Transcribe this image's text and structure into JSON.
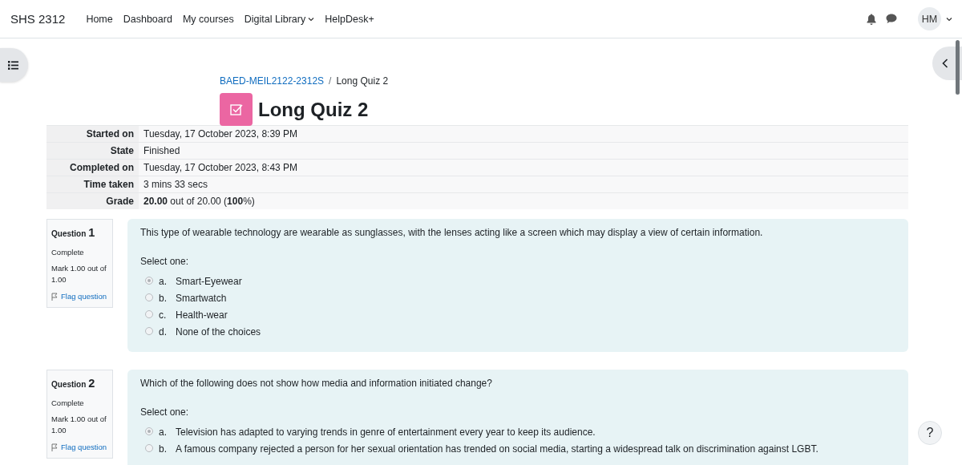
{
  "header": {
    "site_name": "SHS 2312",
    "nav": [
      {
        "label": "Home",
        "dropdown": false
      },
      {
        "label": "Dashboard",
        "dropdown": false
      },
      {
        "label": "My courses",
        "dropdown": false
      },
      {
        "label": "Digital Library",
        "dropdown": true
      },
      {
        "label": "HelpDesk+",
        "dropdown": false
      }
    ],
    "user_initials": "HM"
  },
  "breadcrumb_separator": "/",
  "breadcrumb": [
    {
      "label": "BAED-MEIL2122-2312S",
      "link": true
    },
    {
      "label": "Long Quiz 2",
      "link": false
    }
  ],
  "page_title": "Long Quiz 2",
  "summary": [
    {
      "label": "Started on",
      "value": "Tuesday, 17 October 2023, 8:39 PM"
    },
    {
      "label": "State",
      "value": "Finished"
    },
    {
      "label": "Completed on",
      "value": "Tuesday, 17 October 2023, 8:43 PM"
    },
    {
      "label": "Time taken",
      "value": "3 mins 33 secs"
    },
    {
      "label": "Grade",
      "value": "**20.00** out of 20.00 (**100**%)"
    }
  ],
  "questions": [
    {
      "number_label": "Question",
      "number": "1",
      "status": "Complete",
      "mark": "Mark 1.00 out of 1.00",
      "flag_label": "Flag question",
      "text": "This type of wearable technology are wearable as sunglasses, with the lenses acting like a screen which may display a view of certain information.",
      "prompt": "Select one:",
      "options": [
        {
          "letter": "a.",
          "text": "Smart-Eyewear",
          "selected": true
        },
        {
          "letter": "b.",
          "text": "Smartwatch",
          "selected": false
        },
        {
          "letter": "c.",
          "text": "Health-wear",
          "selected": false
        },
        {
          "letter": "d.",
          "text": "None of the choices",
          "selected": false
        }
      ]
    },
    {
      "number_label": "Question",
      "number": "2",
      "status": "Complete",
      "mark": "Mark 1.00 out of 1.00",
      "flag_label": "Flag question",
      "text": "Which of the following does not show how media and information initiated change?",
      "prompt": "Select one:",
      "options": [
        {
          "letter": "a.",
          "text": "Television has adapted to varying trends in genre of entertainment every year to keep its audience.",
          "selected": true
        },
        {
          "letter": "b.",
          "text": "A famous company rejected a person for her sexual orientation has trended on social media, starting a widespread talk on discrimination against LGBT.",
          "selected": false
        }
      ]
    }
  ],
  "help_button": "?"
}
